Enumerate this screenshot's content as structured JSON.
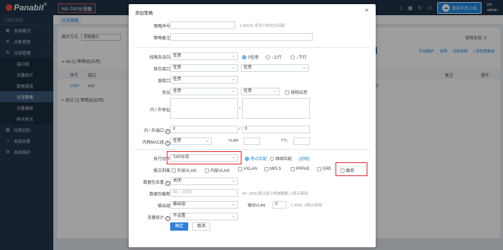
{
  "app": {
    "logo_text": "Panabit",
    "logo_reg": "®",
    "product_tag": "NG-TAP分流器",
    "cloud_button": "旅游华南上线",
    "user_name": "tsh",
    "user_role": "admin"
  },
  "sidebar": {
    "search_placeholder": "功能名搜索",
    "items": [
      {
        "label": "系统概况",
        "icon": "dashboard-icon"
      },
      {
        "label": "对象管理",
        "icon": "object-icon"
      },
      {
        "label": "分流管理",
        "icon": "split-icon"
      }
    ],
    "sub_items": [
      "端口组",
      "流量统计",
      "数据通道",
      "分流策略",
      "流量编排",
      "网卡抓包"
    ],
    "active_sub": "分流策略",
    "more_items": [
      {
        "label": "应用识别",
        "icon": "app-icon"
      },
      {
        "label": "系统告警",
        "icon": "bell-icon"
      },
      {
        "label": "系统维护",
        "icon": "gear-icon"
      }
    ]
  },
  "background": {
    "tab": "分流策略",
    "display_label": "展示方式",
    "display_value": "表格展示",
    "count_label": "策略条数: 6",
    "group1": "∨ ab [1]  策略组(启用)",
    "header_no": "序号",
    "header_port": "接口",
    "header_note": "备注",
    "header_ops": "操作",
    "row_no": "1000",
    "row_port": "any",
    "row_val": "100",
    "group2": "> 测试 [1]  策略组(启用)",
    "actions": [
      "手动维护",
      "说明",
      "动态刷新",
      "+添加策略组"
    ]
  },
  "modal": {
    "title": "添加策略",
    "policy_no_label": "策略序号",
    "policy_no_hint": "1-65535,序号小的优先匹配",
    "policy_note_label": "策略备注",
    "line_dir_label": "线路及流向",
    "line_value": "任意",
    "dir_options": [
      "S任意",
      "↑上行",
      "↓下行"
    ],
    "dir_selected": 0,
    "first_port_label": "首包接口",
    "first_port_value": "任意",
    "first_port_value2": "任意",
    "src_port_label": "源接口",
    "src_port_value": "任意",
    "protocol_label": "协议",
    "protocol_value": "任意",
    "protocol_value2": "任意",
    "exclude_app_label": "排除应用",
    "inner_outer_addr_label": "内 / 外地址",
    "addr_sep": "/",
    "inner_outer_port_label": "内 / 外端口",
    "port_value1": "0",
    "port_value2": "0",
    "port_sep": "/",
    "inner_mac_label": "内网MAC组",
    "mac_value": "任意",
    "vlan_label": "VLAN",
    "ttl_label": "TTL",
    "action_label": "执行动作",
    "action_value": "TAP分流",
    "stop_match_label": "停止匹配",
    "continue_match_label": "继续匹配",
    "desc_link": "[说明]",
    "strip_label": "报文剥离",
    "strip_options": [
      "外层VLAN",
      "内层VLAN",
      "VXLAN",
      "MPLS",
      "PPPoE",
      "GRE",
      "截荷"
    ],
    "payload_label": "数据包去重",
    "payload_value": "关闭",
    "trunc_label": "数据包截断",
    "trunc_placeholder": "40 ~ 1500",
    "trunc_hint": "40~1500,超过部分将被截断, 0表示禁用",
    "out_group_label": "输出组",
    "out_group_value": "输出组",
    "out_vlan_label": "输出VLAN",
    "out_vlan_value": "0",
    "out_vlan_hint": "1-4095, 0表示禁用",
    "flow_stat_label": "流量统计",
    "flow_stat_value": "不设置",
    "ok_label": "确定",
    "cancel_label": "取消"
  },
  "colors": {
    "accent": "#2f7fd8",
    "highlight": "#e02020",
    "topbar": "#1f3247",
    "sidebar": "#23364b"
  }
}
